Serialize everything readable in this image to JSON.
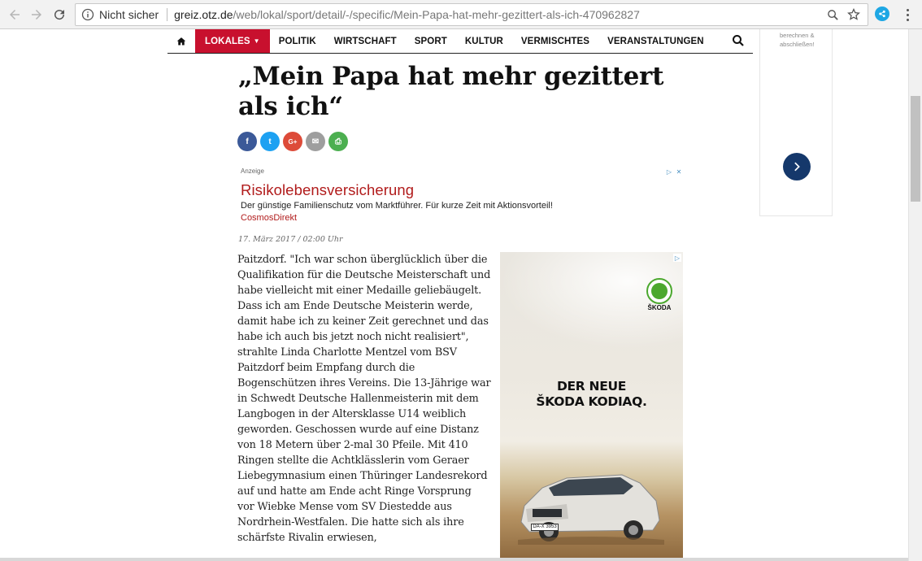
{
  "browser": {
    "security_label": "Nicht sicher",
    "url_host": "greiz.otz.de",
    "url_path": "/web/lokal/sport/detail/-/specific/Mein-Papa-hat-mehr-gezittert-als-ich-470962827"
  },
  "nav": {
    "items": [
      {
        "label": "LOKALES",
        "active": true
      },
      {
        "label": "POLITIK"
      },
      {
        "label": "WIRTSCHAFT"
      },
      {
        "label": "SPORT"
      },
      {
        "label": "KULTUR"
      },
      {
        "label": "VERMISCHTES"
      },
      {
        "label": "VERANSTALTUNGEN"
      }
    ],
    "accent_color": "#c8102e"
  },
  "sidebar": {
    "text": "berechnen & abschließen!"
  },
  "article": {
    "title": "„Mein Papa hat mehr gezittert als ich“",
    "dateline": "17. März 2017 / 02:00 Uhr",
    "body": "Paitzdorf. \"Ich war schon überglücklich über die Qualifikation für die Deutsche Meisterschaft und habe vielleicht mit einer Medaille geliebäugelt. Dass ich am Ende Deutsche Meisterin werde, damit habe ich zu keiner Zeit gerechnet und das habe ich auch bis jetzt noch nicht realisiert\", strahlte Linda Charlotte Mentzel vom BSV Paitzdorf beim Empfang durch die Bogenschützen ihres Vereins. Die 13-Jährige war in Schwedt Deutsche Hallenmeisterin mit dem Langbogen in der Altersklasse U14 weiblich geworden. Geschossen wurde auf eine Distanz von 18 Metern über 2-mal 30 Pfeile. Mit 410 Ringen stellte die Achtklässlerin vom Geraer Liebegymnasium einen Thüringer Landesrekord auf und hatte am Ende acht Ringe Vorsprung vor Wiebke Mense vom SV Diestedde aus Nordrhein-Westfalen. Die hatte sich als ihre schärfste Rivalin erwiesen,"
  },
  "share": [
    {
      "icon": "facebook-icon",
      "glyph": "f",
      "color": "#3b5998"
    },
    {
      "icon": "twitter-icon",
      "glyph": "t",
      "color": "#1da1f2"
    },
    {
      "icon": "google-plus-icon",
      "glyph": "G+",
      "color": "#dd4b39"
    },
    {
      "icon": "email-icon",
      "glyph": "✉",
      "color": "#9e9e9e"
    },
    {
      "icon": "print-icon",
      "glyph": "⎙",
      "color": "#4caf50"
    }
  ],
  "text_ad": {
    "label": "Anzeige",
    "headline": "Risikolebensversicherung",
    "description": "Der günstige Familienschutz vom Marktführer. Für kurze Zeit mit Aktionsvorteil!",
    "advertiser": "CosmosDirekt"
  },
  "display_ad": {
    "brand": "ŠKODA",
    "claim_line1": "DER NEUE",
    "claim_line2": "ŠKODA KODIAQ.",
    "plate": "DA-X 3953"
  }
}
